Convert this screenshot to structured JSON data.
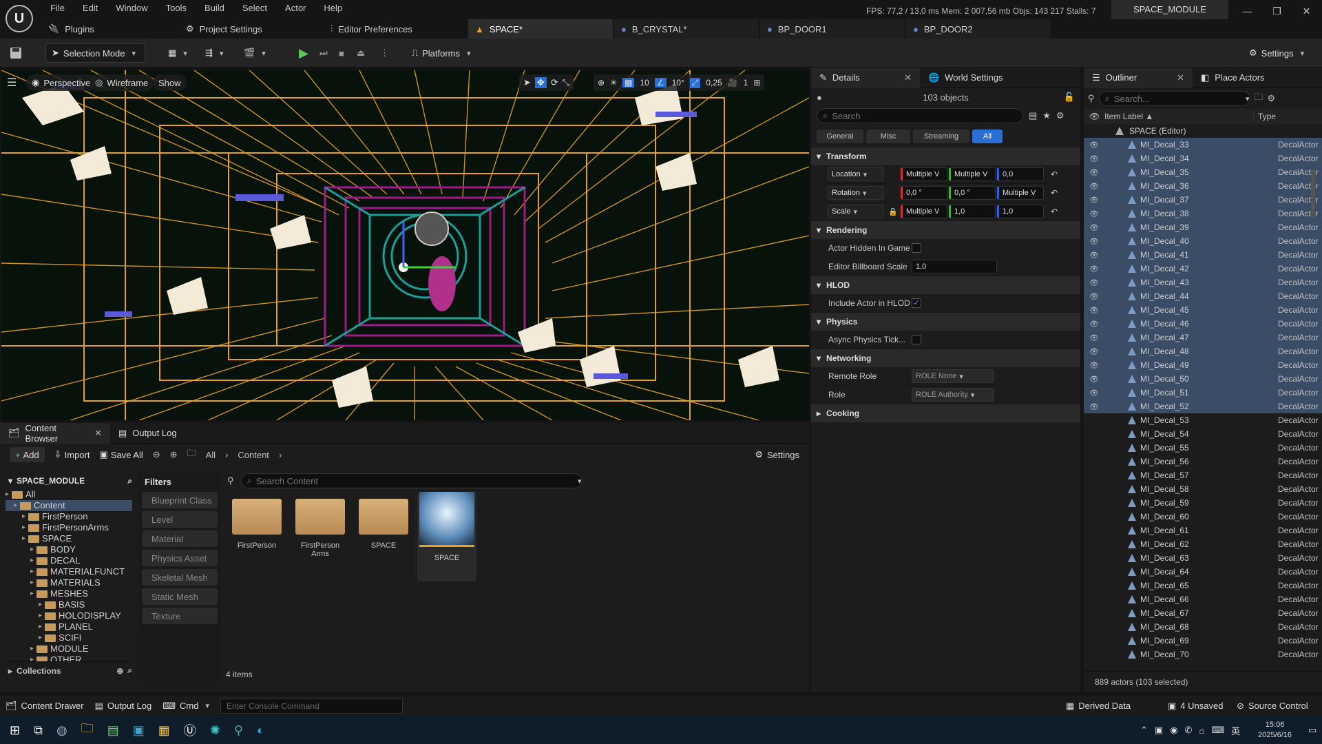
{
  "menu": [
    "File",
    "Edit",
    "Window",
    "Tools",
    "Build",
    "Select",
    "Actor",
    "Help"
  ],
  "stats": "FPS: 77,2  /  13,0 ms   Mem: 2 007,56 mb   Objs: 143 217   Stalls: 7",
  "project_name": "SPACE_MODULE",
  "window_controls": [
    "—",
    "❐",
    "✕"
  ],
  "tabs": {
    "plugins": "Plugins",
    "project_settings": "Project Settings",
    "editor_prefs": "Editor Preferences",
    "docs": [
      "SPACE*",
      "B_CRYSTAL*",
      "BP_DOOR1",
      "BP_DOOR2"
    ]
  },
  "toolbar": {
    "selection_mode": "Selection Mode",
    "platforms": "Platforms",
    "settings": "Settings"
  },
  "viewport": {
    "perspective": "Perspective",
    "wireframe": "Wireframe",
    "show": "Show",
    "grid_snap": "10",
    "rot_snap": "10°",
    "scale_snap": "0,25",
    "cam_speed": "1"
  },
  "details": {
    "tab": "Details",
    "world_tab": "World Settings",
    "count": "103 objects",
    "search_placeholder": "Search",
    "filters": [
      "General",
      "Misc",
      "Streaming",
      "All"
    ],
    "sections": {
      "transform": "Transform",
      "rendering": "Rendering",
      "hlod": "HLOD",
      "physics": "Physics",
      "networking": "Networking",
      "cooking": "Cooking"
    },
    "location": {
      "label": "Location",
      "x": "Multiple V",
      "y": "Multiple V",
      "z": "0,0"
    },
    "rotation": {
      "label": "Rotation",
      "x": "0,0 °",
      "y": "0,0 °",
      "z": "Multiple V"
    },
    "scale": {
      "label": "Scale",
      "x": "Multiple V",
      "y": "1,0",
      "z": "1,0"
    },
    "actor_hidden": "Actor Hidden In Game",
    "billboard_scale": {
      "label": "Editor Billboard Scale",
      "value": "1,0"
    },
    "include_hlod": "Include Actor in HLOD",
    "async_physics": "Async Physics Tick...",
    "remote_role": {
      "label": "Remote Role",
      "value": "ROLE None"
    },
    "role": {
      "label": "Role",
      "value": "ROLE Authority"
    }
  },
  "outliner": {
    "tab": "Outliner",
    "place_actors": "Place Actors",
    "search_placeholder": "Search...",
    "col_label": "Item Label ▲",
    "col_type": "Type",
    "root": "SPACE (Editor)",
    "rows": [
      {
        "label": "MI_Decal_33",
        "type": "DecalActor",
        "sel": true
      },
      {
        "label": "MI_Decal_34",
        "type": "DecalActor",
        "sel": true
      },
      {
        "label": "MI_Decal_35",
        "type": "DecalActor",
        "sel": true
      },
      {
        "label": "MI_Decal_36",
        "type": "DecalActor",
        "sel": true
      },
      {
        "label": "MI_Decal_37",
        "type": "DecalActor",
        "sel": true
      },
      {
        "label": "MI_Decal_38",
        "type": "DecalActor",
        "sel": true
      },
      {
        "label": "MI_Decal_39",
        "type": "DecalActor",
        "sel": true
      },
      {
        "label": "MI_Decal_40",
        "type": "DecalActor",
        "sel": true
      },
      {
        "label": "MI_Decal_41",
        "type": "DecalActor",
        "sel": true
      },
      {
        "label": "MI_Decal_42",
        "type": "DecalActor",
        "sel": true
      },
      {
        "label": "MI_Decal_43",
        "type": "DecalActor",
        "sel": true
      },
      {
        "label": "MI_Decal_44",
        "type": "DecalActor",
        "sel": true
      },
      {
        "label": "MI_Decal_45",
        "type": "DecalActor",
        "sel": true
      },
      {
        "label": "MI_Decal_46",
        "type": "DecalActor",
        "sel": true
      },
      {
        "label": "MI_Decal_47",
        "type": "DecalActor",
        "sel": true
      },
      {
        "label": "MI_Decal_48",
        "type": "DecalActor",
        "sel": true
      },
      {
        "label": "MI_Decal_49",
        "type": "DecalActor",
        "sel": true
      },
      {
        "label": "MI_Decal_50",
        "type": "DecalActor",
        "sel": true
      },
      {
        "label": "MI_Decal_51",
        "type": "DecalActor",
        "sel": true
      },
      {
        "label": "MI_Decal_52",
        "type": "DecalActor",
        "sel": true
      },
      {
        "label": "MI_Decal_53",
        "type": "DecalActor",
        "sel": false
      },
      {
        "label": "MI_Decal_54",
        "type": "DecalActor",
        "sel": false
      },
      {
        "label": "MI_Decal_55",
        "type": "DecalActor",
        "sel": false
      },
      {
        "label": "MI_Decal_56",
        "type": "DecalActor",
        "sel": false
      },
      {
        "label": "MI_Decal_57",
        "type": "DecalActor",
        "sel": false
      },
      {
        "label": "MI_Decal_58",
        "type": "DecalActor",
        "sel": false
      },
      {
        "label": "MI_Decal_59",
        "type": "DecalActor",
        "sel": false
      },
      {
        "label": "MI_Decal_60",
        "type": "DecalActor",
        "sel": false
      },
      {
        "label": "MI_Decal_61",
        "type": "DecalActor",
        "sel": false
      },
      {
        "label": "MI_Decal_62",
        "type": "DecalActor",
        "sel": false
      },
      {
        "label": "MI_Decal_63",
        "type": "DecalActor",
        "sel": false
      },
      {
        "label": "MI_Decal_64",
        "type": "DecalActor",
        "sel": false
      },
      {
        "label": "MI_Decal_65",
        "type": "DecalActor",
        "sel": false
      },
      {
        "label": "MI_Decal_66",
        "type": "DecalActor",
        "sel": false
      },
      {
        "label": "MI_Decal_67",
        "type": "DecalActor",
        "sel": false
      },
      {
        "label": "MI_Decal_68",
        "type": "DecalActor",
        "sel": false
      },
      {
        "label": "MI_Decal_69",
        "type": "DecalActor",
        "sel": false
      },
      {
        "label": "MI_Decal_70",
        "type": "DecalActor",
        "sel": false
      }
    ],
    "footer": "889 actors (103 selected)"
  },
  "content_browser": {
    "tab": "Content Browser",
    "output_tab": "Output Log",
    "add": "Add",
    "import": "Import",
    "save_all": "Save All",
    "crumb_all": "All",
    "crumb_content": "Content",
    "settings": "Settings",
    "root": "SPACE_MODULE",
    "tree": [
      {
        "label": "All",
        "indent": 0
      },
      {
        "label": "Content",
        "indent": 1
      },
      {
        "label": "FirstPerson",
        "indent": 2
      },
      {
        "label": "FirstPersonArms",
        "indent": 2
      },
      {
        "label": "SPACE",
        "indent": 2
      },
      {
        "label": "BODY",
        "indent": 3
      },
      {
        "label": "DECAL",
        "indent": 3
      },
      {
        "label": "MATERIALFUNCT",
        "indent": 3
      },
      {
        "label": "MATERIALS",
        "indent": 3
      },
      {
        "label": "MESHES",
        "indent": 3
      },
      {
        "label": "BASIS",
        "indent": 4
      },
      {
        "label": "HOLODISPLAY",
        "indent": 4
      },
      {
        "label": "PLANEL",
        "indent": 4
      },
      {
        "label": "SCIFI",
        "indent": 4
      },
      {
        "label": "MODULE",
        "indent": 3
      },
      {
        "label": "OTHER",
        "indent": 3
      }
    ],
    "collections": "Collections",
    "filters_title": "Filters",
    "filters": [
      "Blueprint Class",
      "Level",
      "Material",
      "Physics Asset",
      "Skeletal Mesh",
      "Static Mesh",
      "Texture"
    ],
    "search_placeholder": "Search Content",
    "assets": [
      {
        "label": "FirstPerson",
        "kind": "folder"
      },
      {
        "label": "FirstPerson Arms",
        "kind": "folder"
      },
      {
        "label": "SPACE",
        "kind": "folder"
      },
      {
        "label": "SPACE",
        "kind": "level"
      }
    ],
    "item_count": "4 items"
  },
  "statusbar": {
    "content_drawer": "Content Drawer",
    "output_log": "Output Log",
    "cmd": "Cmd",
    "console_placeholder": "Enter Console Command",
    "derived_data": "Derived Data",
    "unsaved": "4 Unsaved",
    "source_control": "Source Control"
  },
  "taskbar": {
    "time": "15:06",
    "date": "2025/6/16",
    "ime": "英"
  }
}
